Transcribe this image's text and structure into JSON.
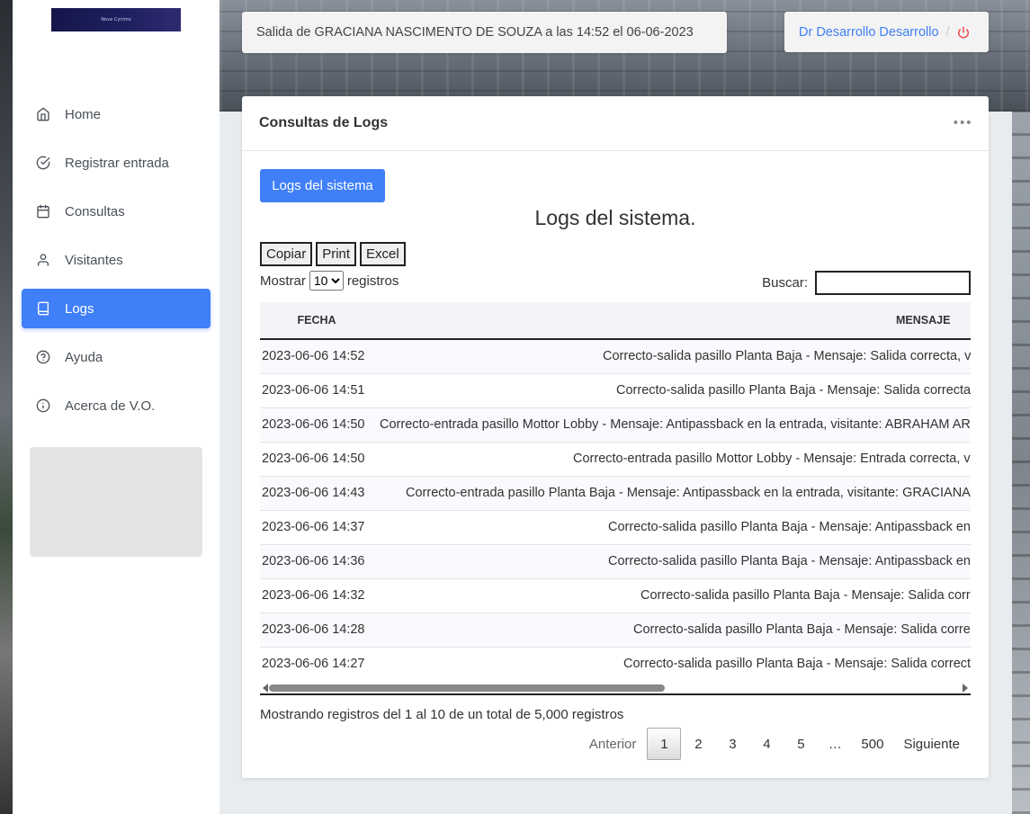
{
  "header": {
    "notice": "Salida de GRACIANA NASCIMENTO DE SOUZA a las 14:52 el 06-06-2023",
    "user_name": "Dr Desarrollo Desarrollo",
    "separator": "/",
    "logout_icon": "power-icon",
    "logo_text": "Nova Cynimo"
  },
  "sidebar": {
    "items": [
      {
        "label": "Home",
        "icon": "home-icon"
      },
      {
        "label": "Registrar entrada",
        "icon": "check-circle-icon"
      },
      {
        "label": "Consultas",
        "icon": "calendar-icon"
      },
      {
        "label": "Visitantes",
        "icon": "user-icon"
      },
      {
        "label": "Logs",
        "icon": "book-icon",
        "active": true
      },
      {
        "label": "Ayuda",
        "icon": "help-circle-icon"
      },
      {
        "label": "Acerca de V.O.",
        "icon": "info-icon"
      }
    ]
  },
  "card": {
    "title": "Consultas de Logs",
    "menu_icon": "more-horizontal-icon",
    "primary_button": "Logs del sistema",
    "heading": "Logs del sistema.",
    "export_buttons": [
      "Copiar",
      "Print",
      "Excel"
    ],
    "length": {
      "prefix": "Mostrar",
      "value": "10",
      "suffix": "registros",
      "options": [
        "10"
      ]
    },
    "search": {
      "label": "Buscar:",
      "value": ""
    },
    "table": {
      "columns": [
        "FECHA",
        "MENSAJE"
      ],
      "rows": [
        {
          "fecha": "2023-06-06 14:52",
          "mensaje": "Correcto-salida pasillo Planta Baja - Mensaje: Salida correcta, v"
        },
        {
          "fecha": "2023-06-06 14:51",
          "mensaje": "Correcto-salida pasillo Planta Baja - Mensaje: Salida correcta"
        },
        {
          "fecha": "2023-06-06 14:50",
          "mensaje": "Correcto-entrada pasillo Mottor Lobby - Mensaje: Antipassback en la entrada, visitante: ABRAHAM AR"
        },
        {
          "fecha": "2023-06-06 14:50",
          "mensaje": "Correcto-entrada pasillo Mottor Lobby - Mensaje: Entrada correcta, v"
        },
        {
          "fecha": "2023-06-06 14:43",
          "mensaje": "Correcto-entrada pasillo Planta Baja - Mensaje: Antipassback en la entrada, visitante: GRACIANA"
        },
        {
          "fecha": "2023-06-06 14:37",
          "mensaje": "Correcto-salida pasillo Planta Baja - Mensaje: Antipassback en"
        },
        {
          "fecha": "2023-06-06 14:36",
          "mensaje": "Correcto-salida pasillo Planta Baja - Mensaje: Antipassback en"
        },
        {
          "fecha": "2023-06-06 14:32",
          "mensaje": "Correcto-salida pasillo Planta Baja - Mensaje: Salida corr"
        },
        {
          "fecha": "2023-06-06 14:28",
          "mensaje": "Correcto-salida pasillo Planta Baja - Mensaje: Salida corre"
        },
        {
          "fecha": "2023-06-06 14:27",
          "mensaje": "Correcto-salida pasillo Planta Baja - Mensaje: Salida correct"
        }
      ]
    },
    "info": "Mostrando registros del 1 al 10 de un total de 5,000 registros",
    "pagination": {
      "previous": "Anterior",
      "pages": [
        "1",
        "2",
        "3",
        "4",
        "5",
        "…",
        "500"
      ],
      "current": "1",
      "next": "Siguiente"
    }
  },
  "colors": {
    "accent": "#3f7ff7",
    "logout": "#ee4444"
  }
}
